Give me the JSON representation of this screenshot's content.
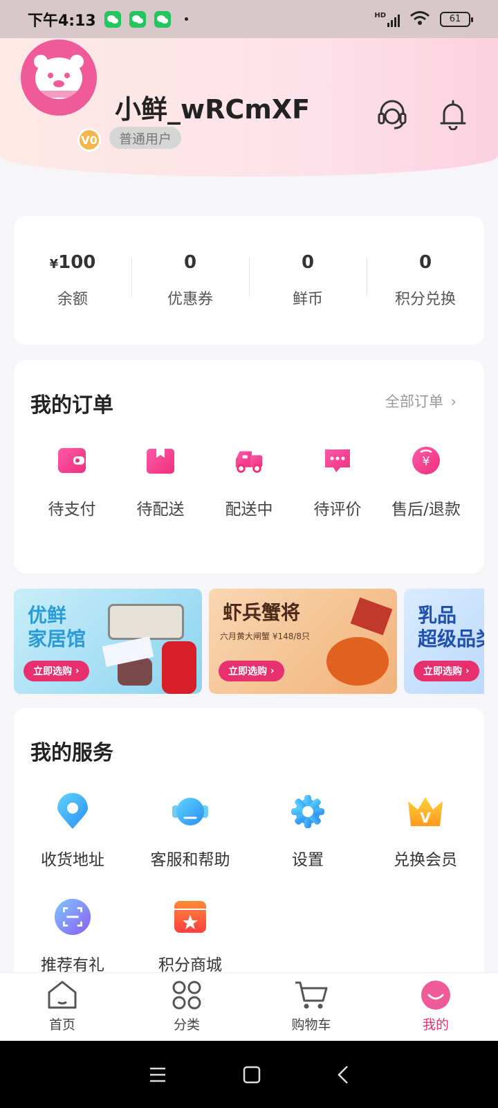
{
  "status_bar": {
    "time": "下午4:13",
    "battery": "61",
    "network": "HD"
  },
  "profile": {
    "username": "小鲜_wRCmXF",
    "level_tag": "普通用户",
    "level_badge": "V0"
  },
  "stats": [
    {
      "currency": "¥",
      "value": "100",
      "label": "余额"
    },
    {
      "currency": "",
      "value": "0",
      "label": "优惠券"
    },
    {
      "currency": "",
      "value": "0",
      "label": "鲜币"
    },
    {
      "currency": "",
      "value": "0",
      "label": "积分兑换"
    }
  ],
  "orders": {
    "title": "我的订单",
    "all_label": "全部订单",
    "items": [
      {
        "label": "待支付",
        "icon": "wallet-icon"
      },
      {
        "label": "待配送",
        "icon": "package-icon"
      },
      {
        "label": "配送中",
        "icon": "delivery-truck-icon"
      },
      {
        "label": "待评价",
        "icon": "comment-icon"
      },
      {
        "label": "售后/退款",
        "icon": "refund-icon"
      }
    ]
  },
  "banners": [
    {
      "title_line1": "优鲜",
      "title_line2": "家居馆",
      "subtitle": "",
      "button": "立即选购",
      "color": "#2a9bd6"
    },
    {
      "title_line1": "虾兵蟹将",
      "title_line2": "",
      "subtitle": "六月黄大闸蟹 ¥148/8只",
      "button": "立即选购",
      "color": "#4a2a1a"
    },
    {
      "title_line1": "乳品",
      "title_line2": "超级品类",
      "subtitle": "",
      "button": "立即选购",
      "color": "#1f4fb0"
    }
  ],
  "services": {
    "title": "我的服务",
    "items": [
      {
        "label": "收货地址",
        "icon": "location-pin-icon"
      },
      {
        "label": "客服和帮助",
        "icon": "customer-service-icon"
      },
      {
        "label": "设置",
        "icon": "settings-gear-icon"
      },
      {
        "label": "兑换会员",
        "icon": "vip-crown-icon"
      },
      {
        "label": "推荐有礼",
        "icon": "scan-icon"
      },
      {
        "label": "积分商城",
        "icon": "store-icon"
      }
    ]
  },
  "bottom_nav": [
    {
      "label": "首页",
      "icon": "home-icon",
      "active": false
    },
    {
      "label": "分类",
      "icon": "category-icon",
      "active": false
    },
    {
      "label": "购物车",
      "icon": "cart-icon",
      "active": false
    },
    {
      "label": "我的",
      "icon": "profile-icon",
      "active": true
    }
  ],
  "colors": {
    "accent": "#e9306f",
    "pink": "#f05a99",
    "header_start": "#ffe9e6",
    "header_end": "#fbd2df"
  }
}
